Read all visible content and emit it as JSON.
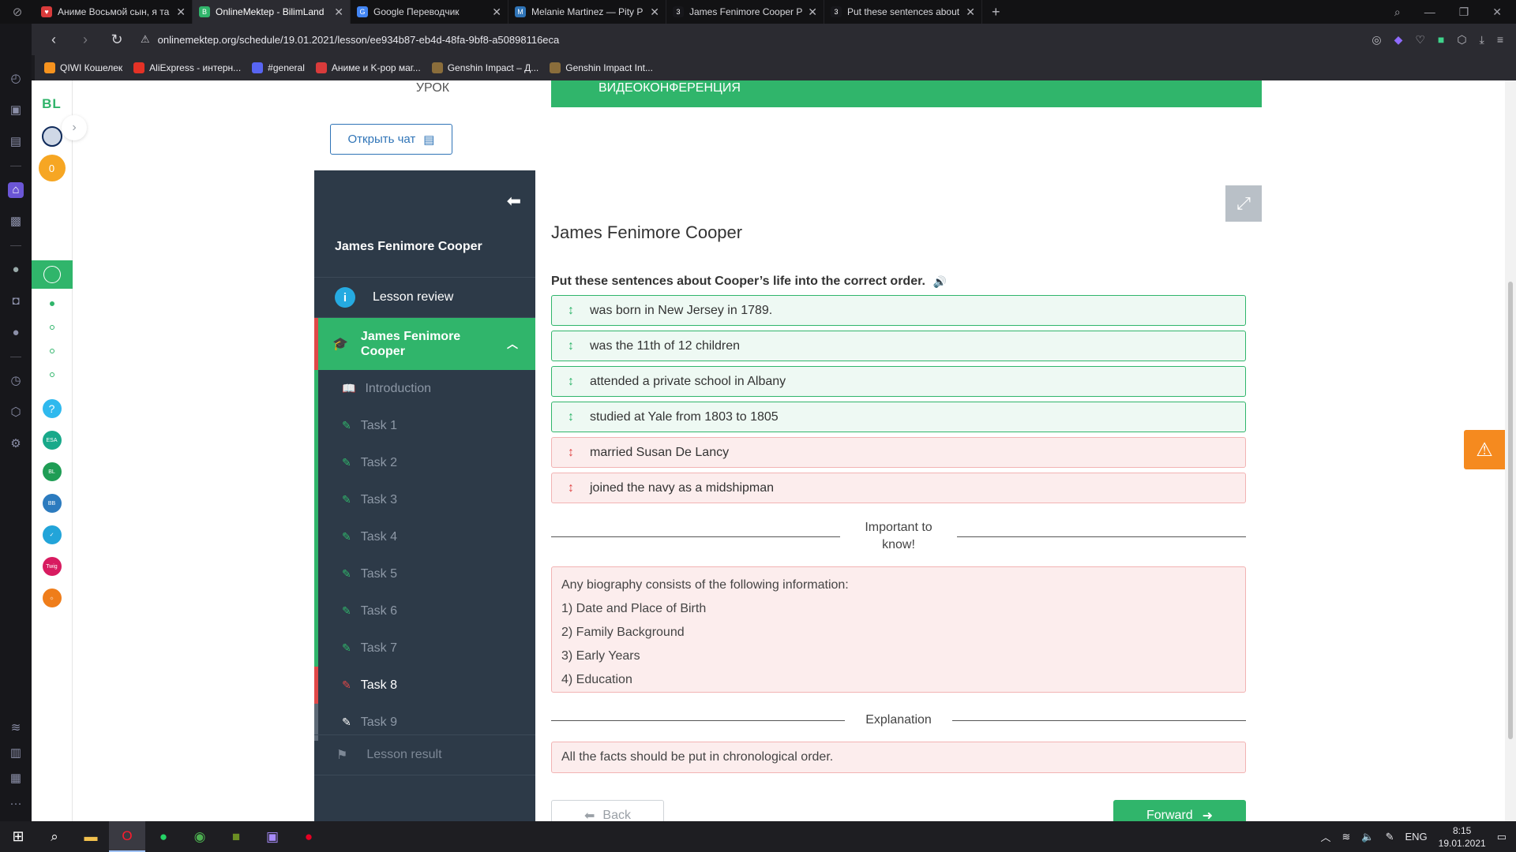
{
  "browser": {
    "tabs": [
      {
        "title": "Аниме Восьмой сын, я та",
        "fav": "♥",
        "color": "#d93b3b",
        "active": false
      },
      {
        "title": "OnlineMektep - BilimLand",
        "fav": "B",
        "color": "#30b56b",
        "active": true
      },
      {
        "title": "Google Переводчик",
        "fav": "G",
        "color": "#4285f4",
        "active": false
      },
      {
        "title": "Melanie Martinez — Pity P",
        "fav": "M",
        "color": "#2f74b7",
        "active": false
      },
      {
        "title": "James Fenimore Cooper Pu",
        "fav": "3",
        "color": "#17171b",
        "active": false
      },
      {
        "title": "Put these sentences about",
        "fav": "3",
        "color": "#17171b",
        "active": false
      }
    ],
    "url": "onlinemektep.org/schedule/19.01.2021/lesson/ee934b87-eb4d-48fa-9bf8-a50898116eca",
    "bookmarks": [
      {
        "label": "QIWI Кошелек",
        "color": "#f7931e"
      },
      {
        "label": "AliExpress - интерн...",
        "color": "#e43226"
      },
      {
        "label": "#general",
        "color": "#5865f2"
      },
      {
        "label": "Аниме и K-pop маг...",
        "color": "#d93b3b"
      },
      {
        "label": "Genshin Impact – Д...",
        "color": "#8a6d3b"
      },
      {
        "label": "Genshin Impact Int...",
        "color": "#8a6d3b"
      }
    ]
  },
  "app": {
    "logo": "BL",
    "coins": "0"
  },
  "lesson": {
    "tab_lesson": "УРОК",
    "tab_video": "ВИДЕОКОНФЕРЕНЦИЯ",
    "open_chat": "Открыть чат",
    "nav_title": "James Fenimore Cooper",
    "review": "Lesson review",
    "module": "James Fenimore Cooper",
    "items": [
      "Introduction",
      "Task 1",
      "Task 2",
      "Task 3",
      "Task 4",
      "Task 5",
      "Task 6",
      "Task 7",
      "Task 8",
      "Task 9"
    ],
    "result": "Lesson result"
  },
  "task": {
    "title": "James Fenimore Cooper",
    "instruction": "Put these sentences about Cooper’s life into the correct order.",
    "sentences": [
      {
        "text": "was born in New Jersey in 1789.",
        "correct": true
      },
      {
        "text": "was the 11th of 12 children",
        "correct": true
      },
      {
        "text": "attended a private school in Albany",
        "correct": true
      },
      {
        "text": "studied at Yale from 1803 to 1805",
        "correct": true
      },
      {
        "text": "married Susan De Lancy",
        "correct": false
      },
      {
        "text": "joined the navy as a midshipman",
        "correct": false
      }
    ],
    "important_label": "Important to know!",
    "info_lines": [
      "Any biography consists of the following information:",
      "1) Date and Place of Birth",
      "2) Family Background",
      "3) Early Years",
      "4) Education"
    ],
    "explanation_label": "Explanation",
    "explanation": "All the facts should be put in chronological order.",
    "back": "Back",
    "forward": "Forward"
  },
  "taskbar": {
    "lang": "ENG",
    "time": "8:15",
    "date": "19.01.2021"
  }
}
